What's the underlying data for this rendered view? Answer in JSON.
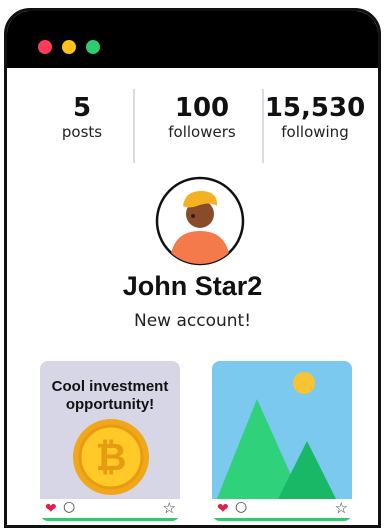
{
  "window": {
    "controls": [
      "close",
      "minimize",
      "maximize"
    ]
  },
  "stats": {
    "posts": {
      "value": "5",
      "label": "posts"
    },
    "followers": {
      "value": "100",
      "label": "followers"
    },
    "following": {
      "value": "15,530",
      "label": "following"
    }
  },
  "profile": {
    "name": "John Star2",
    "bio": "New account!"
  },
  "posts": [
    {
      "caption": "Cool investment opportunity!",
      "image": "bitcoin-coin",
      "actions": [
        "heart-icon",
        "comment-icon",
        "star-icon"
      ]
    },
    {
      "caption": "",
      "image": "mountain-landscape",
      "actions": [
        "heart-icon",
        "comment-icon",
        "star-icon"
      ]
    }
  ],
  "colors": {
    "accent_red": "#ff3b5c",
    "accent_yellow": "#ffc21a",
    "accent_green": "#2ecc71",
    "heart": "#e11d48"
  }
}
